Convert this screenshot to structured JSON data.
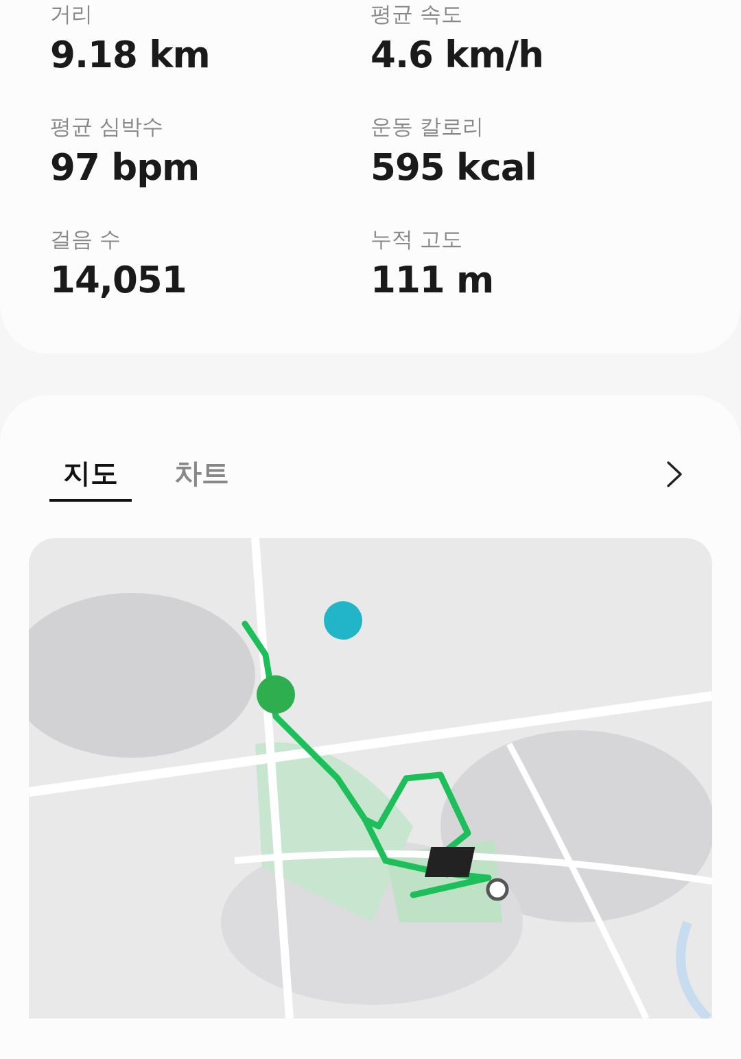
{
  "stats": [
    {
      "label": "거리",
      "value": "9.18 km"
    },
    {
      "label": "평균 속도",
      "value": "4.6 km/h"
    },
    {
      "label": "평균 심박수",
      "value": "97 bpm"
    },
    {
      "label": "운동 칼로리",
      "value": "595 kcal"
    },
    {
      "label": "걸음 수",
      "value": "14,051"
    },
    {
      "label": "누적 고도",
      "value": "111 m"
    }
  ],
  "tabs": [
    {
      "label": "지도",
      "selected": true
    },
    {
      "label": "차트",
      "selected": false
    }
  ]
}
